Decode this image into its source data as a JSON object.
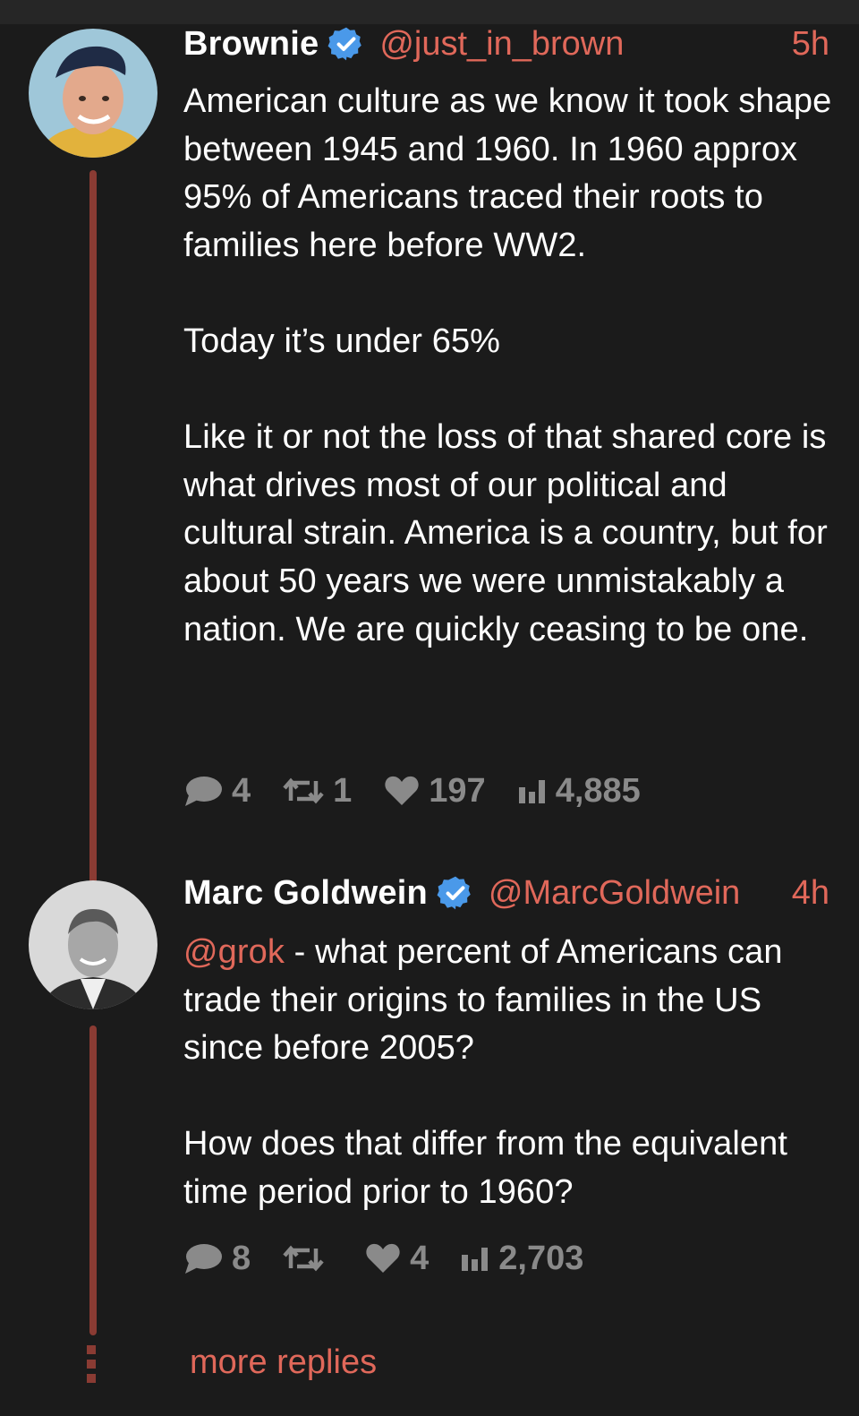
{
  "colors": {
    "background": "#1b1b1b",
    "accent": "#e0685a",
    "thread_line": "#8a3b33",
    "verified": "#4a99e9",
    "meta": "#8a8a8a"
  },
  "tweets": [
    {
      "name": "Brownie",
      "verified": true,
      "handle": "@just_in_brown",
      "time": "5h",
      "body": {
        "p1": "American culture as we know it took shape between 1945 and 1960. In 1960 approx 95% of Americans traced their roots to families here before WW2.",
        "p2": "Today it’s under 65%",
        "p3": "Like it or not the loss of that shared core is what drives most of our political and cultural strain. America is a country, but for about 50 years we were unmistakably a nation. We are quickly ceasing to be one."
      },
      "stats": {
        "replies": "4",
        "reposts": "1",
        "likes": "197",
        "views": "4,885"
      },
      "icons": [
        "reply-icon",
        "repost-icon",
        "like-icon",
        "views-icon"
      ]
    },
    {
      "name": "Marc Goldwein",
      "verified": true,
      "handle": "@MarcGoldwein",
      "time": "4h",
      "body": {
        "mention": "@grok",
        "p1_rest": " - what percent of Americans can trade their origins to families in the US since before 2005?",
        "p2": "How does that differ from the equivalent time period prior to 1960?"
      },
      "stats": {
        "replies": "8",
        "reposts": "",
        "likes": "4",
        "views": "2,703"
      },
      "icons": [
        "reply-icon",
        "repost-icon",
        "like-icon",
        "views-icon"
      ]
    }
  ],
  "footer": {
    "more_replies": "more replies"
  }
}
